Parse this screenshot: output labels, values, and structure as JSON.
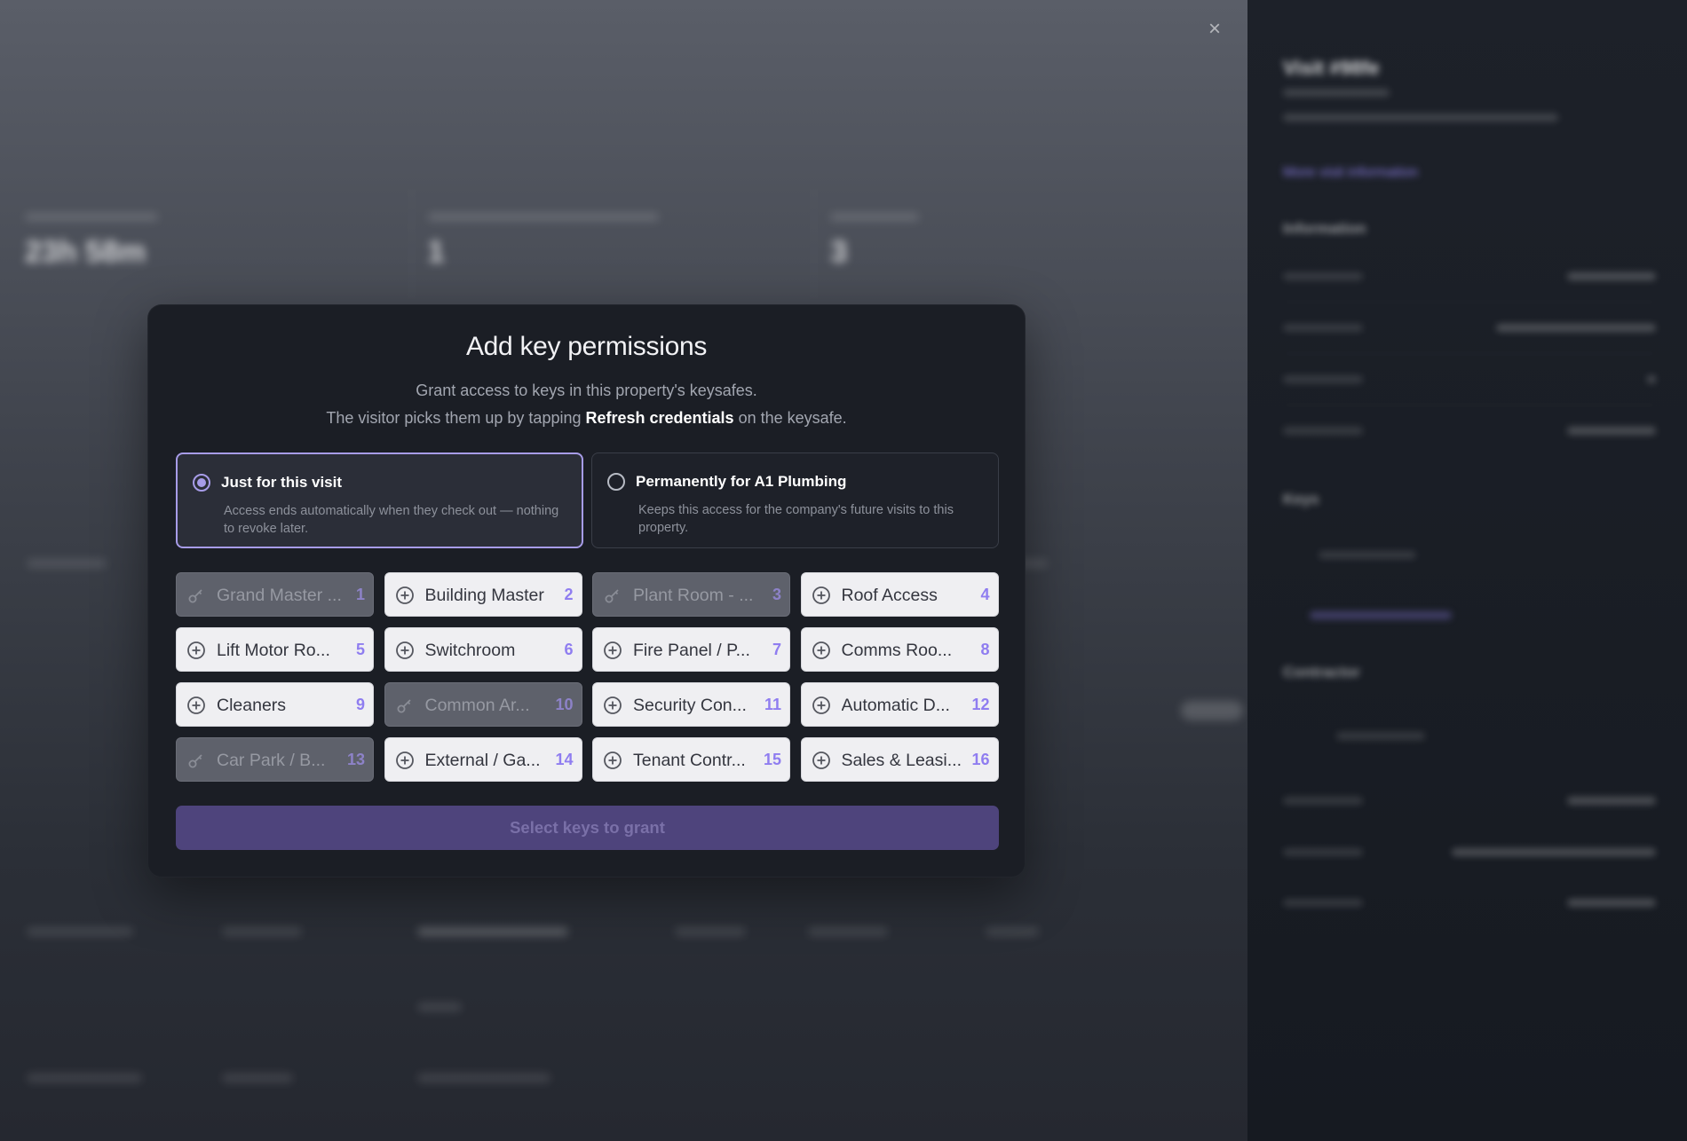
{
  "modal": {
    "title": "Add key permissions",
    "description_line1": "Grant access to keys in this property's keysafes.",
    "description_line2_prefix": "The visitor picks them up by tapping ",
    "description_line2_bold": "Refresh credentials",
    "description_line2_suffix": " on the keysafe.",
    "options": [
      {
        "title": "Just for this visit",
        "description": "Access ends automatically when they check out — nothing to revoke later.",
        "selected": true
      },
      {
        "title": "Permanently for A1 Plumbing",
        "description": "Keeps this access for the company's future visits to this property.",
        "selected": false
      }
    ],
    "keys": [
      {
        "name": "Grand Master ...",
        "number": "1",
        "disabled": true,
        "icon": "key-icon"
      },
      {
        "name": "Building Master",
        "number": "2",
        "disabled": false,
        "icon": "plus-circle-icon"
      },
      {
        "name": "Plant Room - ...",
        "number": "3",
        "disabled": true,
        "icon": "key-icon"
      },
      {
        "name": "Roof Access",
        "number": "4",
        "disabled": false,
        "icon": "plus-circle-icon"
      },
      {
        "name": "Lift Motor Ro...",
        "number": "5",
        "disabled": false,
        "icon": "plus-circle-icon"
      },
      {
        "name": "Switchroom",
        "number": "6",
        "disabled": false,
        "icon": "plus-circle-icon"
      },
      {
        "name": "Fire Panel / P...",
        "number": "7",
        "disabled": false,
        "icon": "plus-circle-icon"
      },
      {
        "name": "Comms Roo...",
        "number": "8",
        "disabled": false,
        "icon": "plus-circle-icon"
      },
      {
        "name": "Cleaners",
        "number": "9",
        "disabled": false,
        "icon": "plus-circle-icon"
      },
      {
        "name": "Common Ar...",
        "number": "10",
        "disabled": true,
        "icon": "key-icon"
      },
      {
        "name": "Security Con...",
        "number": "11",
        "disabled": false,
        "icon": "plus-circle-icon"
      },
      {
        "name": "Automatic D...",
        "number": "12",
        "disabled": false,
        "icon": "plus-circle-icon"
      },
      {
        "name": "Car Park / B...",
        "number": "13",
        "disabled": true,
        "icon": "key-icon"
      },
      {
        "name": "External / Ga...",
        "number": "14",
        "disabled": false,
        "icon": "plus-circle-icon"
      },
      {
        "name": "Tenant Contr...",
        "number": "15",
        "disabled": false,
        "icon": "plus-circle-icon"
      },
      {
        "name": "Sales & Leasi...",
        "number": "16",
        "disabled": false,
        "icon": "plus-circle-icon"
      }
    ],
    "submit_label": "Select keys to grant"
  },
  "background": {
    "close_icon": "close-icon",
    "stat_value_1": "23h 58m",
    "stat_value_2": "1",
    "stat_value_3": "3"
  },
  "colors": {
    "accent": "#a79ce8",
    "key_number": "#8f7df0",
    "button_disabled": "#4e447c",
    "modal_bg": "#1b1e25"
  }
}
